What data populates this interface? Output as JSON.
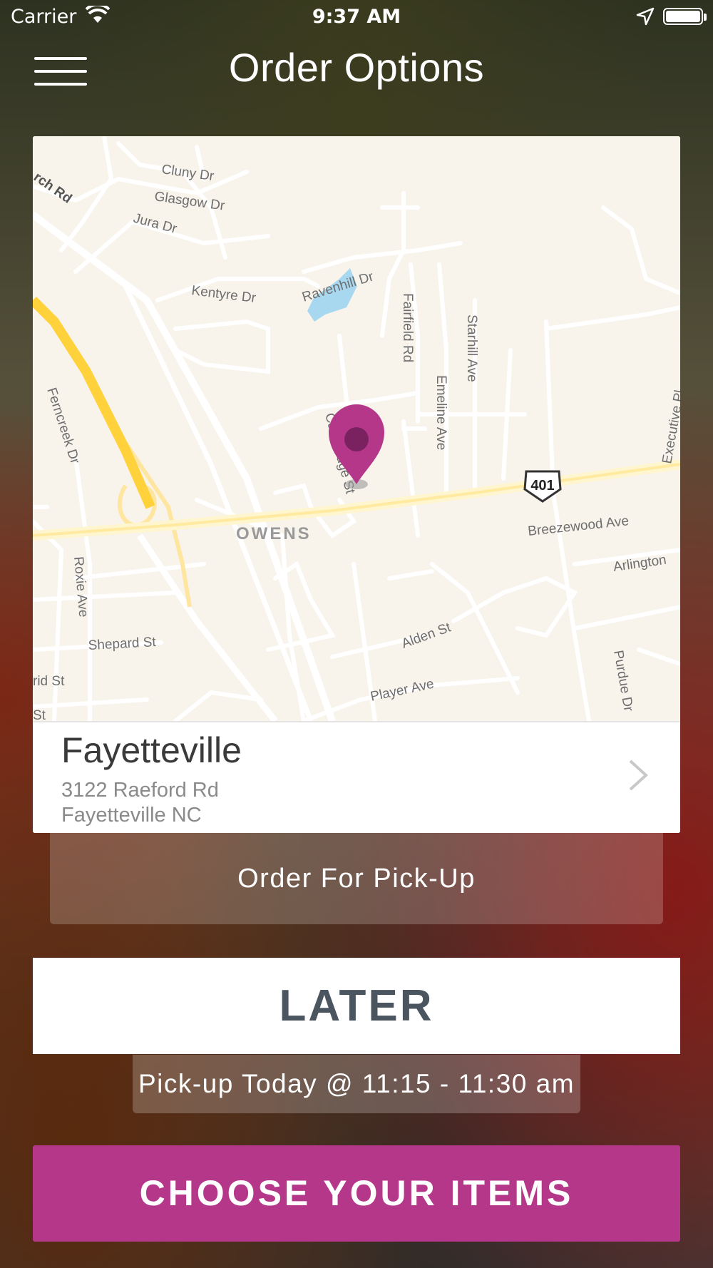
{
  "status_bar": {
    "carrier": "Carrier",
    "time": "9:37 AM"
  },
  "nav": {
    "title": "Order Options",
    "menu_icon": "hamburger-menu-icon"
  },
  "map": {
    "street_labels": {
      "cluny": "Cluny Dr",
      "glasgow": "Glasgow Dr",
      "jura": "Jura Dr",
      "church": "rch Rd",
      "kentyre": "Kentyre Dr",
      "ravenhill": "Ravenhill Dr",
      "fairfield": "Fairfield Rd",
      "starhill": "Starhill Ave",
      "emeline": "Emeline Ave",
      "executive": "Executive Pl",
      "ferncreek": "Ferncreek Dr",
      "cambridge": "Cambridge St",
      "owens": "OWENS",
      "breezewood": "Breezewood Ave",
      "arlington": "Arlington",
      "roxie": "Roxie Ave",
      "shepard": "Shepard St",
      "alden": "Alden St",
      "purdue": "Purdue Dr",
      "rid": "rid St",
      "player": "Player Ave",
      "st": "St",
      "route": "401"
    },
    "pin_color": "#b5378a"
  },
  "location": {
    "name": "Fayetteville",
    "address_line1": "3122 Raeford Rd",
    "address_line2": "Fayetteville NC"
  },
  "order_type": "Order For Pick-Up",
  "timing": "LATER",
  "pickup_time": "Pick-up Today @ 11:15 - 11:30 am",
  "cta": {
    "label": "CHOOSE YOUR ITEMS",
    "color": "#b5378a"
  }
}
